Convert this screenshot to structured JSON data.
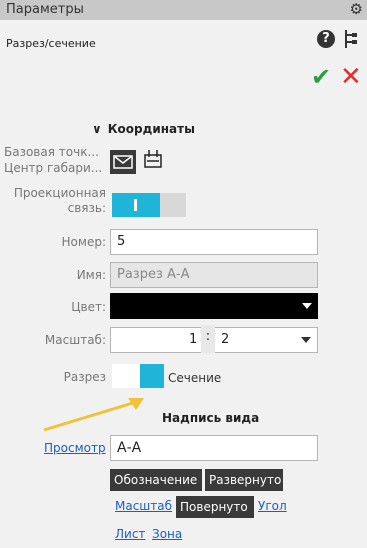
{
  "window": {
    "title": "Параметры"
  },
  "header": {
    "subtitle": "Разрез/сечение"
  },
  "section": {
    "title": "Координаты"
  },
  "base_point": {
    "label1": "Базовая точк...",
    "label2": "Центр габари..."
  },
  "projection": {
    "label1": "Проекционная",
    "label2": "связь:"
  },
  "number": {
    "label": "Номер:",
    "value": "5"
  },
  "name": {
    "label": "Имя:",
    "value": "Разрез А-А"
  },
  "color": {
    "label": "Цвет:",
    "value": "#000000"
  },
  "scale": {
    "label": "Масштаб:",
    "num": "1",
    "sep": ":",
    "den": "2"
  },
  "cut": {
    "label": "Разрез",
    "right_label": "Сечение"
  },
  "view_caption": {
    "title": "Надпись вида",
    "preview_link": "Просмотр",
    "text": "А-А"
  },
  "buttons": {
    "designation": "Обозначение",
    "expanded": "Развернуто",
    "rotated": "Повернуто"
  },
  "links": {
    "scale": "Масштаб",
    "angle": "Угол",
    "sheet": "Лист",
    "zone": "Зона"
  },
  "colors": {
    "accent": "#1eb5d9",
    "ok": "#2e9c3f",
    "cancel": "#e0302b",
    "arrow": "#f0c23a"
  }
}
